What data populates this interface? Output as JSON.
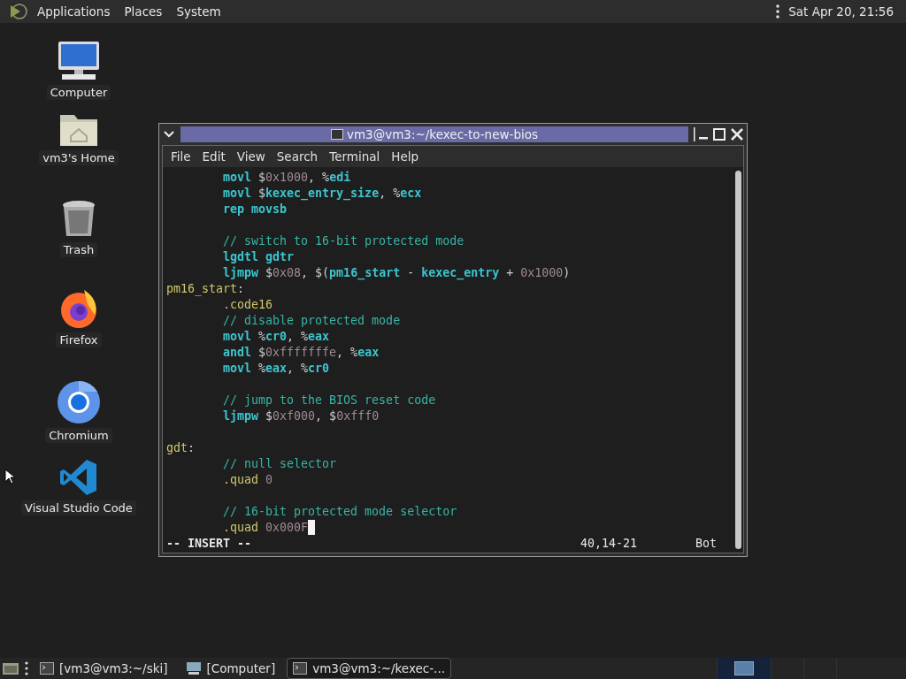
{
  "top_panel": {
    "menus": [
      {
        "label": "Applications"
      },
      {
        "label": "Places"
      },
      {
        "label": "System"
      }
    ],
    "clock": "Sat Apr 20, 21:56"
  },
  "desktop_icons": [
    {
      "label": "Computer",
      "kind": "computer"
    },
    {
      "label": "vm3's Home",
      "kind": "home"
    },
    {
      "label": "Trash",
      "kind": "trash"
    },
    {
      "label": "Firefox",
      "kind": "firefox"
    },
    {
      "label": "Chromium",
      "kind": "chromium"
    },
    {
      "label": "Visual Studio Code",
      "kind": "vscode"
    }
  ],
  "terminal": {
    "title": "vm3@vm3:~/kexec-to-new-bios",
    "menu": [
      "File",
      "Edit",
      "View",
      "Search",
      "Terminal",
      "Help"
    ],
    "lines": [
      {
        "kind": "code",
        "cursor": false,
        "segments": [
          {
            "kind": "instr",
            "text": "movl"
          },
          {
            "kind": "plain",
            "text": " $"
          },
          {
            "kind": "num",
            "text": "0x1000"
          },
          {
            "kind": "plain",
            "text": ", %"
          },
          {
            "kind": "instr",
            "text": "edi"
          }
        ]
      },
      {
        "kind": "code",
        "cursor": false,
        "segments": [
          {
            "kind": "instr",
            "text": "movl"
          },
          {
            "kind": "plain",
            "text": " $"
          },
          {
            "kind": "instr",
            "text": "kexec_entry_size"
          },
          {
            "kind": "plain",
            "text": ", %"
          },
          {
            "kind": "instr",
            "text": "ecx"
          }
        ]
      },
      {
        "kind": "code",
        "cursor": false,
        "segments": [
          {
            "kind": "instr",
            "text": "rep movsb"
          }
        ]
      },
      {
        "kind": "blank",
        "cursor": false
      },
      {
        "kind": "code",
        "cursor": false,
        "segments": [
          {
            "kind": "comment",
            "text": "// switch to 16-bit protected mode"
          }
        ]
      },
      {
        "kind": "code",
        "cursor": false,
        "segments": [
          {
            "kind": "instr",
            "text": "lgdtl gdtr"
          }
        ]
      },
      {
        "kind": "code",
        "cursor": false,
        "segments": [
          {
            "kind": "instr",
            "text": "ljmpw"
          },
          {
            "kind": "plain",
            "text": " $"
          },
          {
            "kind": "num",
            "text": "0x08"
          },
          {
            "kind": "plain",
            "text": ", $("
          },
          {
            "kind": "instr",
            "text": "pm16_start"
          },
          {
            "kind": "plain",
            "text": " - "
          },
          {
            "kind": "instr",
            "text": "kexec_entry"
          },
          {
            "kind": "plain",
            "text": " + "
          },
          {
            "kind": "num",
            "text": "0x1000"
          },
          {
            "kind": "plain",
            "text": ")"
          }
        ]
      },
      {
        "kind": "label",
        "cursor": false,
        "segments": [
          {
            "kind": "label",
            "text": "pm16_start"
          },
          {
            "kind": "plain",
            "text": ":"
          }
        ]
      },
      {
        "kind": "code",
        "cursor": false,
        "segments": [
          {
            "kind": "directive",
            "text": ".code16"
          }
        ]
      },
      {
        "kind": "code",
        "cursor": false,
        "segments": [
          {
            "kind": "comment",
            "text": "// disable protected mode"
          }
        ]
      },
      {
        "kind": "code",
        "cursor": false,
        "segments": [
          {
            "kind": "instr",
            "text": "movl"
          },
          {
            "kind": "plain",
            "text": " %"
          },
          {
            "kind": "instr",
            "text": "cr0"
          },
          {
            "kind": "plain",
            "text": ", %"
          },
          {
            "kind": "instr",
            "text": "eax"
          }
        ]
      },
      {
        "kind": "code",
        "cursor": false,
        "segments": [
          {
            "kind": "instr",
            "text": "andl"
          },
          {
            "kind": "plain",
            "text": " $"
          },
          {
            "kind": "num",
            "text": "0xfffffffe"
          },
          {
            "kind": "plain",
            "text": ", %"
          },
          {
            "kind": "instr",
            "text": "eax"
          }
        ]
      },
      {
        "kind": "code",
        "cursor": false,
        "segments": [
          {
            "kind": "instr",
            "text": "movl"
          },
          {
            "kind": "plain",
            "text": " %"
          },
          {
            "kind": "instr",
            "text": "eax"
          },
          {
            "kind": "plain",
            "text": ", %"
          },
          {
            "kind": "instr",
            "text": "cr0"
          }
        ]
      },
      {
        "kind": "blank",
        "cursor": false
      },
      {
        "kind": "code",
        "cursor": false,
        "segments": [
          {
            "kind": "comment",
            "text": "// jump to the BIOS reset code"
          }
        ]
      },
      {
        "kind": "code",
        "cursor": false,
        "segments": [
          {
            "kind": "instr",
            "text": "ljmpw"
          },
          {
            "kind": "plain",
            "text": " $"
          },
          {
            "kind": "num",
            "text": "0xf000"
          },
          {
            "kind": "plain",
            "text": ", $"
          },
          {
            "kind": "num",
            "text": "0xfff0"
          }
        ]
      },
      {
        "kind": "blank",
        "cursor": false
      },
      {
        "kind": "label",
        "cursor": false,
        "segments": [
          {
            "kind": "label",
            "text": "gdt"
          },
          {
            "kind": "plain",
            "text": ":"
          }
        ]
      },
      {
        "kind": "code",
        "cursor": false,
        "segments": [
          {
            "kind": "comment",
            "text": "// null selector"
          }
        ]
      },
      {
        "kind": "code",
        "cursor": false,
        "segments": [
          {
            "kind": "directive",
            "text": ".quad "
          },
          {
            "kind": "num",
            "text": "0"
          }
        ]
      },
      {
        "kind": "blank",
        "cursor": false
      },
      {
        "kind": "code",
        "cursor": false,
        "segments": [
          {
            "kind": "comment",
            "text": "// 16-bit protected mode selector"
          }
        ]
      },
      {
        "kind": "code",
        "cursor": true,
        "segments": [
          {
            "kind": "directive",
            "text": ".quad "
          },
          {
            "kind": "num",
            "text": "0x000F"
          }
        ]
      }
    ],
    "status": {
      "mode": "-- INSERT --",
      "position": "40,14-21",
      "scroll": "Bot"
    }
  },
  "taskbar": {
    "tasks": [
      {
        "label": "[vm3@vm3:~/ski]",
        "kind": "terminal",
        "selected": false
      },
      {
        "label": "[Computer]",
        "kind": "computer",
        "selected": false
      },
      {
        "label": "vm3@vm3:~/kexec-...",
        "kind": "terminal",
        "selected": true
      }
    ],
    "workspaces": [
      {
        "selected": true
      },
      {
        "selected": false
      },
      {
        "selected": false
      },
      {
        "selected": false
      }
    ]
  }
}
